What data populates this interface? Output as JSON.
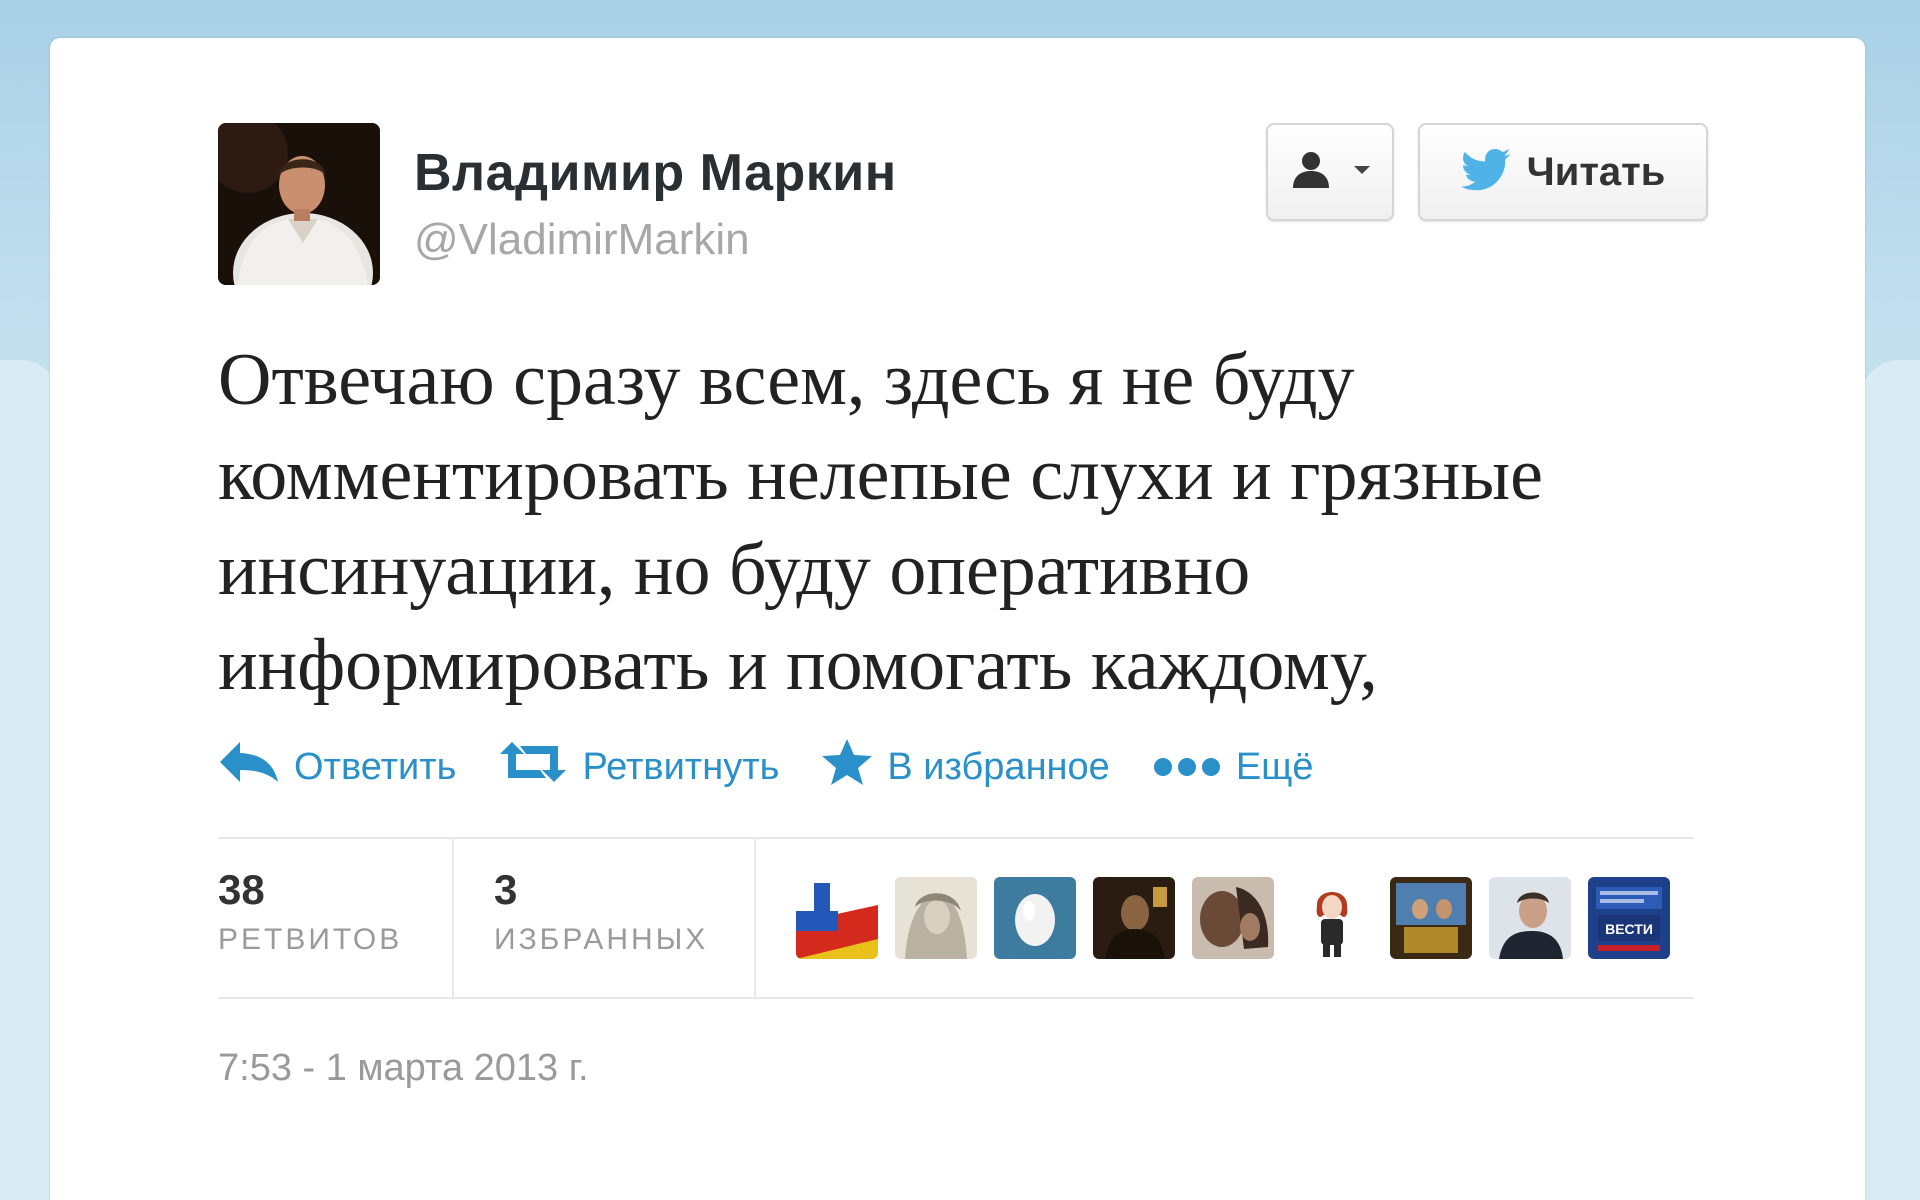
{
  "user": {
    "name": "Владимир Маркин",
    "handle": "@VladimirMarkin"
  },
  "buttons": {
    "follow_label": "Читать"
  },
  "tweet": {
    "lines": [
      "Отвечаю сразу всем, здесь я не буду",
      "комментировать нелепые слухи и грязные",
      "инсинуации, но буду оперативно",
      "информировать и помогать каждому,"
    ]
  },
  "actions": {
    "reply": "Ответить",
    "retweet": "Ретвитнуть",
    "favorite": "В избранное",
    "more": "Ещё"
  },
  "stats": {
    "retweets_count": "38",
    "retweets_label": "РЕТВИТОВ",
    "favorites_count": "3",
    "favorites_label": "ИЗБРАННЫХ"
  },
  "faces": {
    "vesti_label": "ВЕСТИ"
  },
  "timestamp": "7:53 - 1 марта 2013 г.",
  "colors": {
    "link": "#2a90c9",
    "background": "#c0deed",
    "twitter_bird": "#4fb3e8"
  }
}
